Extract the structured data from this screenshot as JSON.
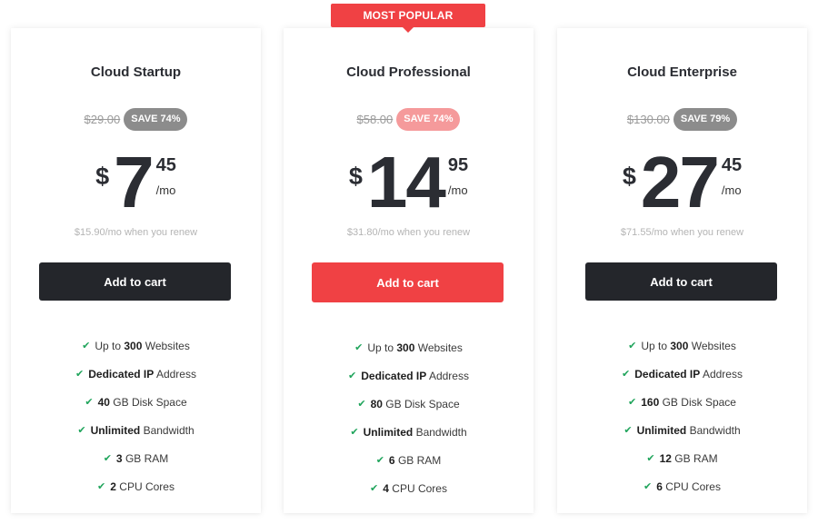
{
  "ribbon": {
    "label": "MOST POPULAR"
  },
  "colors": {
    "accent": "#f04144",
    "dark_button": "#24262b",
    "check": "#1fa45b",
    "badge_gray": "#8c8c8c",
    "badge_pink": "#f59a9b"
  },
  "plans": [
    {
      "name": "Cloud Startup",
      "old_price": "$29.00",
      "save": "SAVE 74%",
      "currency": "$",
      "price_main": "7",
      "price_cents": "45",
      "period": "/mo",
      "renew": "$15.90/mo when you renew",
      "button": "Add to cart",
      "features": [
        {
          "pre": "Up to ",
          "bold": "300",
          "post": " Websites"
        },
        {
          "pre": "",
          "bold": "Dedicated IP",
          "post": " Address"
        },
        {
          "pre": "",
          "bold": "40",
          "post": " GB Disk Space"
        },
        {
          "pre": "",
          "bold": "Unlimited",
          "post": " Bandwidth"
        },
        {
          "pre": "",
          "bold": "3",
          "post": " GB RAM"
        },
        {
          "pre": "",
          "bold": "2",
          "post": " CPU Cores"
        }
      ]
    },
    {
      "name": "Cloud Professional",
      "old_price": "$58.00",
      "save": "SAVE 74%",
      "currency": "$",
      "price_main": "14",
      "price_cents": "95",
      "period": "/mo",
      "renew": "$31.80/mo when you renew",
      "button": "Add to cart",
      "features": [
        {
          "pre": "Up to ",
          "bold": "300",
          "post": " Websites"
        },
        {
          "pre": "",
          "bold": "Dedicated IP",
          "post": " Address"
        },
        {
          "pre": "",
          "bold": "80",
          "post": " GB Disk Space"
        },
        {
          "pre": "",
          "bold": "Unlimited",
          "post": " Bandwidth"
        },
        {
          "pre": "",
          "bold": "6",
          "post": " GB RAM"
        },
        {
          "pre": "",
          "bold": "4",
          "post": " CPU Cores"
        }
      ]
    },
    {
      "name": "Cloud Enterprise",
      "old_price": "$130.00",
      "save": "SAVE 79%",
      "currency": "$",
      "price_main": "27",
      "price_cents": "45",
      "period": "/mo",
      "renew": "$71.55/mo when you renew",
      "button": "Add to cart",
      "features": [
        {
          "pre": "Up to ",
          "bold": "300",
          "post": " Websites"
        },
        {
          "pre": "",
          "bold": "Dedicated IP",
          "post": " Address"
        },
        {
          "pre": "",
          "bold": "160",
          "post": " GB Disk Space"
        },
        {
          "pre": "",
          "bold": "Unlimited",
          "post": " Bandwidth"
        },
        {
          "pre": "",
          "bold": "12",
          "post": " GB RAM"
        },
        {
          "pre": "",
          "bold": "6",
          "post": " CPU Cores"
        }
      ]
    }
  ]
}
